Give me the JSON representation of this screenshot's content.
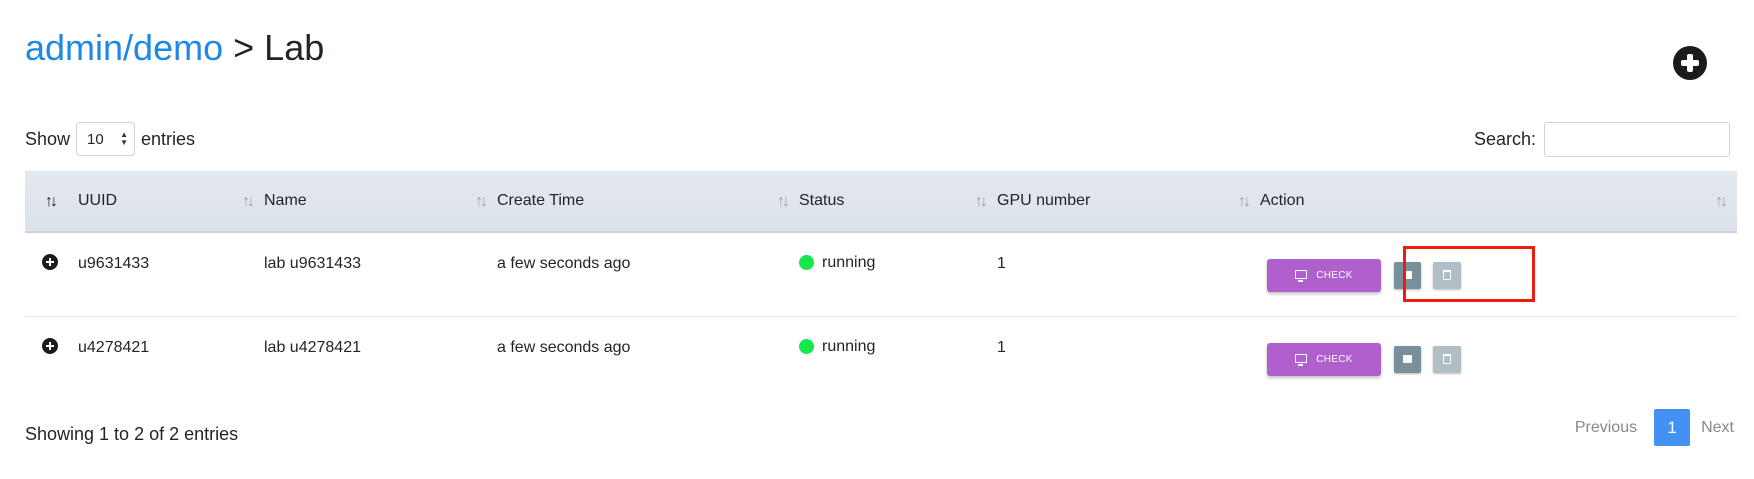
{
  "breadcrumb": {
    "link": "admin/demo",
    "separator": ">",
    "current": "Lab"
  },
  "add_button": {
    "icon": "plus-circle-icon"
  },
  "length_control": {
    "prefix": "Show",
    "value": "10",
    "suffix": "entries"
  },
  "search": {
    "label": "Search:",
    "value": ""
  },
  "table": {
    "headers": [
      "",
      "UUID",
      "Name",
      "Create Time",
      "Status",
      "GPU number",
      "Action"
    ],
    "rows": [
      {
        "uuid": "u9631433",
        "name": "lab u9631433",
        "create_time": "a few seconds ago",
        "status": "running",
        "gpu": "1",
        "check_label": "CHECK"
      },
      {
        "uuid": "u4278421",
        "name": "lab u4278421",
        "create_time": "a few seconds ago",
        "status": "running",
        "gpu": "1",
        "check_label": "CHECK"
      }
    ]
  },
  "footer": {
    "info": "Showing 1 to 2 of 2 entries"
  },
  "pagination": {
    "previous": "Previous",
    "current_page": "1",
    "next": "Next"
  },
  "colors": {
    "link": "#1e88e5",
    "check_button": "#b060cd",
    "status_running": "#14e84b",
    "highlight": "#ee1c10",
    "page_active": "#4391f2"
  }
}
